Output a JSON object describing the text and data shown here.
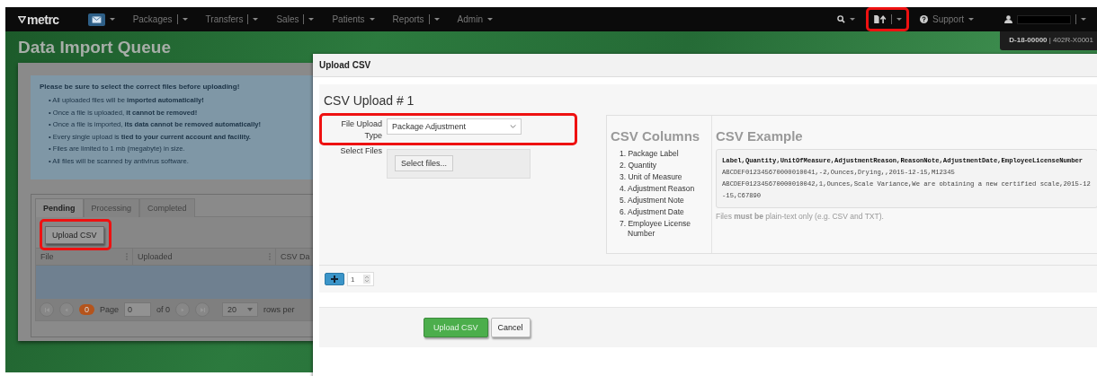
{
  "navbar": {
    "logo": "metrc",
    "items": [
      {
        "label": "Packages",
        "divider": true
      },
      {
        "label": "Transfers",
        "divider": true
      },
      {
        "label": "Sales",
        "divider": true
      },
      {
        "label": "Patients",
        "divider": false
      },
      {
        "label": "Reports",
        "divider": true
      },
      {
        "label": "Admin",
        "divider": false
      }
    ],
    "upload": {
      "highlighted": true
    },
    "support": "Support",
    "user": {
      "redacted": true
    }
  },
  "facility": "**D-18-00000** | 402R-X0001",
  "page": {
    "title": "Data Import Queue",
    "notice": {
      "heading": "Please be sure to select the correct files before uploading!",
      "marker": "•",
      "bullets": [
        "All uploaded files will be **imported automatically!**",
        "Once a file is uploaded, **it cannot be removed!**",
        "Once a file is imported, **its data cannot be removed automatically!**",
        "Every single upload is **tied to your current account and facility.**",
        "Files are limited to 1 mb (megabyte) in size.",
        "All files will be scanned by antivirus software."
      ]
    },
    "tabs": [
      {
        "label": "Pending",
        "selected": true
      },
      {
        "label": "Processing",
        "selected": false
      },
      {
        "label": "Completed",
        "selected": false
      }
    ],
    "upload_button": {
      "label": "Upload CSV",
      "highlighted": true
    },
    "columns": [
      "File",
      "Uploaded",
      "CSV Da"
    ],
    "pager": {
      "count": "0",
      "page_label": "Page",
      "page_value": "0",
      "of": "of 0",
      "rows_value": "20",
      "rows_label": "rows per"
    }
  },
  "modal": {
    "title": "Upload CSV",
    "heading": "CSV Upload # 1",
    "fields": [
      {
        "kind": "select",
        "label": "File Upload Type",
        "value": "Package Adjustment",
        "highlighted": true
      },
      {
        "kind": "file",
        "label": "Select Files",
        "button": "Select files...",
        "highlighted": false
      }
    ],
    "columns_title": "CSV Columns",
    "columns": [
      "1. Package Label",
      "2. Quantity",
      "3. Unit of Measure",
      "4. Adjustment Reason",
      "5. Adjustment Note",
      "6. Adjustment Date",
      "7. Employee License Number"
    ],
    "example_title": "CSV Example",
    "example_lines": [
      {
        "kind": "header",
        "text": "Label,Quantity,UnitOfMeasure,AdjustmentReason,ReasonNote,AdjustmentDate,EmployeeLicenseNumber"
      },
      {
        "kind": "row",
        "text": "ABCDEF012345670000010041,-2,Ounces,Drying,,2015-12-15,M12345"
      },
      {
        "kind": "row",
        "text": "ABCDEF012345670000010042,1,Ounces,Scale Variance,We are obtaining a new certified scale,2015-12-15,C67890"
      }
    ],
    "note": "Files **must be** plain-text only (e.g. CSV and TXT).",
    "count": "1",
    "buttons": [
      {
        "kind": "primary",
        "label": "Upload CSV"
      },
      {
        "kind": "default",
        "label": "Cancel"
      }
    ]
  }
}
